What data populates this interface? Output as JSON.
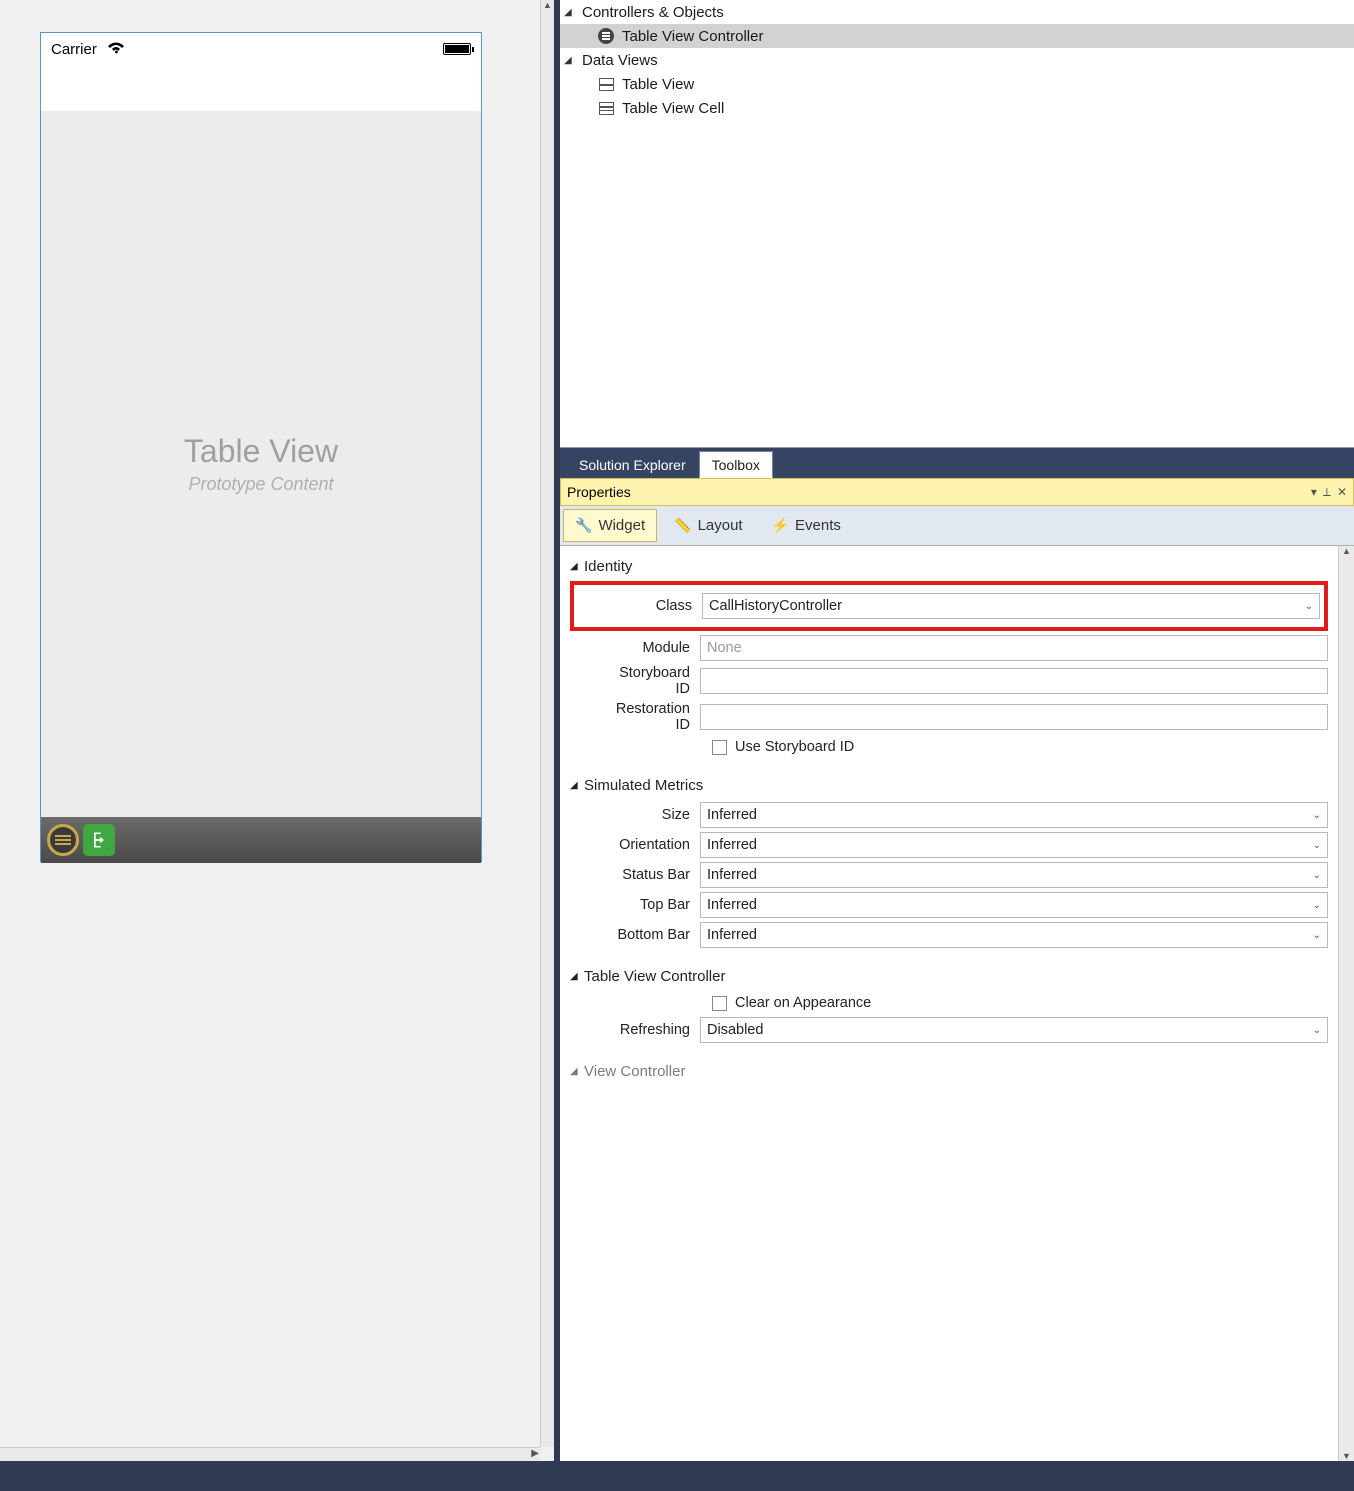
{
  "canvas": {
    "carrier": "Carrier",
    "tableTitle": "Table View",
    "tableSubtitle": "Prototype Content"
  },
  "outline": {
    "group1": "Controllers & Objects",
    "item1": "Table View Controller",
    "group2": "Data Views",
    "item2": "Table View",
    "item3": "Table View Cell"
  },
  "tabs": {
    "solutionExplorer": "Solution Explorer",
    "toolbox": "Toolbox"
  },
  "propsHeader": "Properties",
  "propTabs": {
    "widget": "Widget",
    "layout": "Layout",
    "events": "Events"
  },
  "identity": {
    "sect": "Identity",
    "classLabel": "Class",
    "classValue": "CallHistoryController",
    "moduleLabel": "Module",
    "modulePlaceholder": "None",
    "storyLabel": "Storyboard ID",
    "restLabel": "Restoration ID",
    "useSb": "Use Storyboard ID"
  },
  "sim": {
    "sect": "Simulated Metrics",
    "sizeLabel": "Size",
    "sizeValue": "Inferred",
    "orientLabel": "Orientation",
    "orientValue": "Inferred",
    "statusLabel": "Status Bar",
    "statusValue": "Inferred",
    "topLabel": "Top Bar",
    "topValue": "Inferred",
    "bottomLabel": "Bottom Bar",
    "bottomValue": "Inferred"
  },
  "tvc": {
    "sect": "Table View Controller",
    "clear": "Clear on Appearance",
    "refreshLabel": "Refreshing",
    "refreshValue": "Disabled"
  },
  "vc": {
    "sect": "View Controller"
  }
}
